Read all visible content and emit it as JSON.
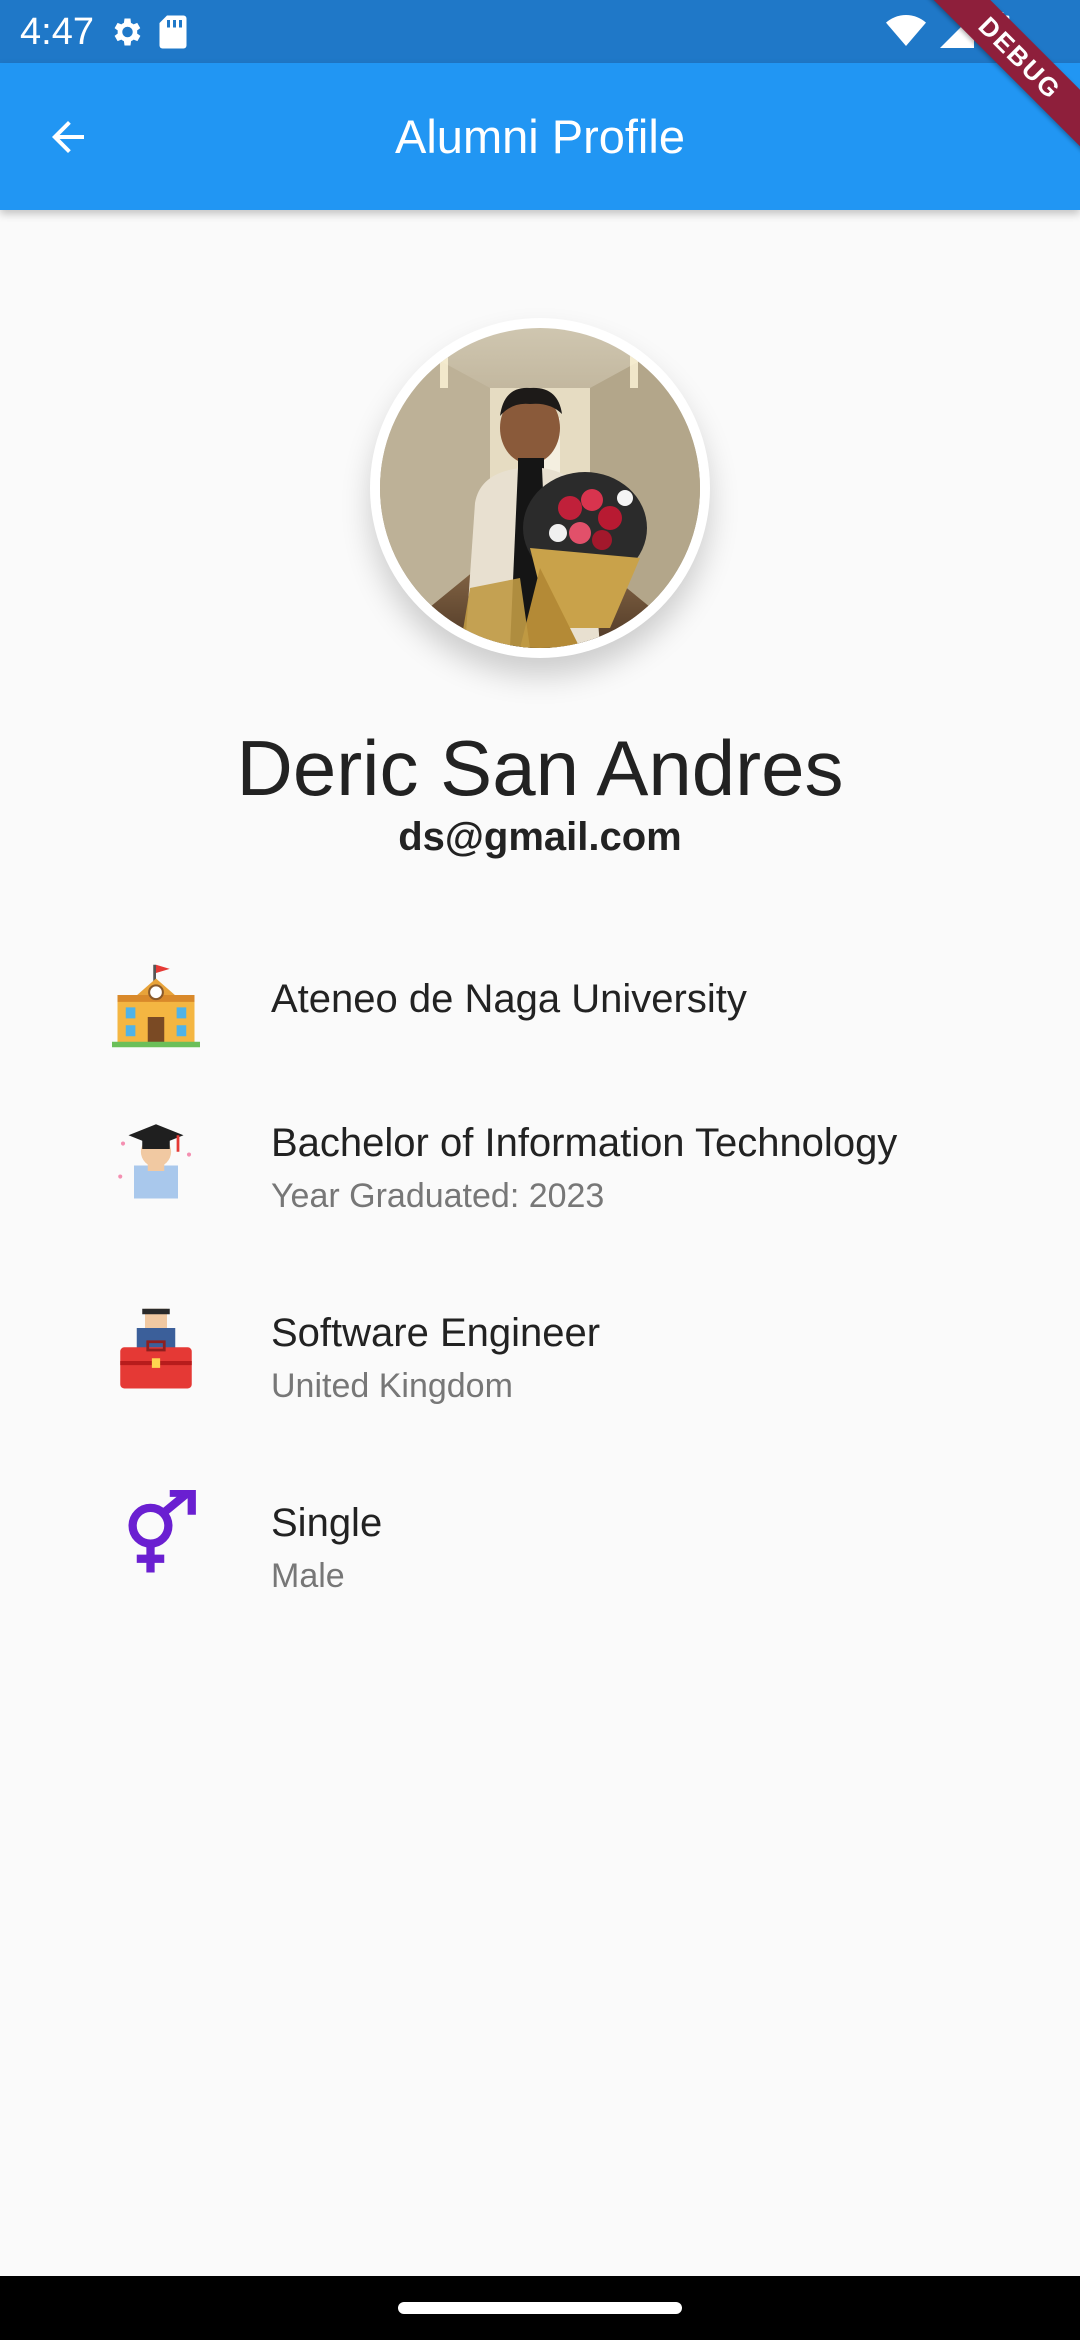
{
  "status_bar": {
    "time": "4:47",
    "left_icons": [
      "settings-icon",
      "sd-card-icon"
    ],
    "right_icons": [
      "wifi-icon",
      "signal-icon",
      "battery-icon"
    ]
  },
  "app_bar": {
    "title": "Alumni Profile",
    "back_icon": "arrow-back-icon",
    "color": "#2196f3"
  },
  "debug_banner": "DEBUG",
  "profile": {
    "name": "Deric San Andres",
    "email": "ds@gmail.com"
  },
  "info": {
    "school": {
      "icon": "school-building-icon",
      "title": "Ateneo de Naga University"
    },
    "education": {
      "icon": "graduate-icon",
      "title": "Bachelor of Information Technology",
      "subtitle": "Year Graduated: 2023"
    },
    "job": {
      "icon": "job-worker-icon",
      "title": "Software Engineer",
      "subtitle": "United Kingdom"
    },
    "personal": {
      "icon": "gender-icon",
      "title": "Single",
      "subtitle": "Male"
    }
  }
}
